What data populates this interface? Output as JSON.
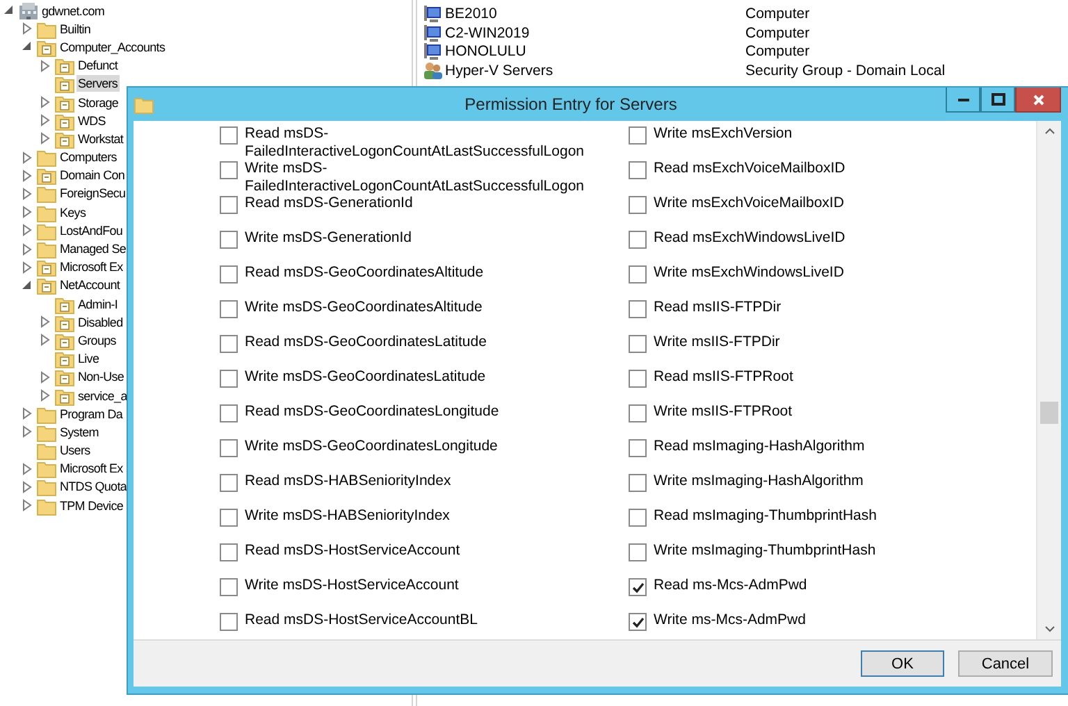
{
  "tree": [
    {
      "label": "gdwnet.com",
      "kind": "domain",
      "expandable": true,
      "expanded": true,
      "selected": false,
      "children": [
        {
          "label": "Builtin",
          "kind": "container",
          "expandable": true,
          "expanded": false,
          "selected": false
        },
        {
          "label": "Computer_Accounts",
          "kind": "ou",
          "expandable": true,
          "expanded": true,
          "selected": false,
          "children": [
            {
              "label": "Defunct",
              "kind": "ou",
              "expandable": true,
              "expanded": false,
              "selected": false
            },
            {
              "label": "Servers",
              "kind": "ou",
              "expandable": false,
              "expanded": false,
              "selected": true
            },
            {
              "label": "Storage",
              "kind": "ou",
              "expandable": true,
              "expanded": false,
              "selected": false
            },
            {
              "label": "WDS",
              "kind": "ou",
              "expandable": true,
              "expanded": false,
              "selected": false
            },
            {
              "label": "Workstat",
              "kind": "ou",
              "expandable": true,
              "expanded": false,
              "selected": false
            }
          ]
        },
        {
          "label": "Computers",
          "kind": "container",
          "expandable": true,
          "expanded": false,
          "selected": false
        },
        {
          "label": "Domain Con",
          "kind": "ou",
          "expandable": true,
          "expanded": false,
          "selected": false
        },
        {
          "label": "ForeignSecu",
          "kind": "container",
          "expandable": true,
          "expanded": false,
          "selected": false
        },
        {
          "label": "Keys",
          "kind": "container",
          "expandable": true,
          "expanded": false,
          "selected": false
        },
        {
          "label": "LostAndFou",
          "kind": "container",
          "expandable": true,
          "expanded": false,
          "selected": false
        },
        {
          "label": "Managed Se",
          "kind": "container",
          "expandable": true,
          "expanded": false,
          "selected": false
        },
        {
          "label": "Microsoft Ex",
          "kind": "ou",
          "expandable": true,
          "expanded": false,
          "selected": false
        },
        {
          "label": "NetAccount",
          "kind": "ou",
          "expandable": true,
          "expanded": true,
          "selected": false,
          "children": [
            {
              "label": "Admin-I",
              "kind": "ou",
              "expandable": false,
              "expanded": false,
              "selected": false
            },
            {
              "label": "Disabled",
              "kind": "ou",
              "expandable": true,
              "expanded": false,
              "selected": false
            },
            {
              "label": "Groups",
              "kind": "ou",
              "expandable": true,
              "expanded": false,
              "selected": false
            },
            {
              "label": "Live",
              "kind": "ou",
              "expandable": false,
              "expanded": false,
              "selected": false
            },
            {
              "label": "Non-Use",
              "kind": "ou",
              "expandable": true,
              "expanded": false,
              "selected": false
            },
            {
              "label": "service_a",
              "kind": "ou",
              "expandable": true,
              "expanded": false,
              "selected": false
            }
          ]
        },
        {
          "label": "Program Da",
          "kind": "container",
          "expandable": true,
          "expanded": false,
          "selected": false
        },
        {
          "label": "System",
          "kind": "container",
          "expandable": true,
          "expanded": false,
          "selected": false
        },
        {
          "label": "Users",
          "kind": "container",
          "expandable": false,
          "expanded": false,
          "selected": false
        },
        {
          "label": "Microsoft Ex",
          "kind": "container",
          "expandable": true,
          "expanded": false,
          "selected": false
        },
        {
          "label": "NTDS Quota",
          "kind": "container",
          "expandable": true,
          "expanded": false,
          "selected": false
        },
        {
          "label": "TPM Device",
          "kind": "container",
          "expandable": true,
          "expanded": false,
          "selected": false
        }
      ]
    }
  ],
  "objects": [
    {
      "name": "BE2010",
      "type": "Computer",
      "kind": "computer"
    },
    {
      "name": "C2-WIN2019",
      "type": "Computer",
      "kind": "computer"
    },
    {
      "name": "HONOLULU",
      "type": "Computer",
      "kind": "computer"
    },
    {
      "name": "Hyper-V Servers",
      "type": "Security Group - Domain Local",
      "kind": "group"
    }
  ],
  "dialog": {
    "title": "Permission Entry for Servers",
    "columns": [
      [
        {
          "label": "Read msDS-FailedInteractiveLogonCountAtLastSuccessfulLogon",
          "checked": false
        },
        {
          "label": "Write msDS-FailedInteractiveLogonCountAtLastSuccessfulLogon",
          "checked": false
        },
        {
          "label": "Read msDS-GenerationId",
          "checked": false
        },
        {
          "label": "Write msDS-GenerationId",
          "checked": false
        },
        {
          "label": "Read msDS-GeoCoordinatesAltitude",
          "checked": false
        },
        {
          "label": "Write msDS-GeoCoordinatesAltitude",
          "checked": false
        },
        {
          "label": "Read msDS-GeoCoordinatesLatitude",
          "checked": false
        },
        {
          "label": "Write msDS-GeoCoordinatesLatitude",
          "checked": false
        },
        {
          "label": "Read msDS-GeoCoordinatesLongitude",
          "checked": false
        },
        {
          "label": "Write msDS-GeoCoordinatesLongitude",
          "checked": false
        },
        {
          "label": "Read msDS-HABSeniorityIndex",
          "checked": false
        },
        {
          "label": "Write msDS-HABSeniorityIndex",
          "checked": false
        },
        {
          "label": "Read msDS-HostServiceAccount",
          "checked": false
        },
        {
          "label": "Write msDS-HostServiceAccount",
          "checked": false
        },
        {
          "label": "Read msDS-HostServiceAccountBL",
          "checked": false
        }
      ],
      [
        {
          "label": "Write msExchVersion",
          "checked": false
        },
        {
          "label": "Read msExchVoiceMailboxID",
          "checked": false
        },
        {
          "label": "Write msExchVoiceMailboxID",
          "checked": false
        },
        {
          "label": "Read msExchWindowsLiveID",
          "checked": false
        },
        {
          "label": "Write msExchWindowsLiveID",
          "checked": false
        },
        {
          "label": "Read msIIS-FTPDir",
          "checked": false
        },
        {
          "label": "Write msIIS-FTPDir",
          "checked": false
        },
        {
          "label": "Read msIIS-FTPRoot",
          "checked": false
        },
        {
          "label": "Write msIIS-FTPRoot",
          "checked": false
        },
        {
          "label": "Read msImaging-HashAlgorithm",
          "checked": false
        },
        {
          "label": "Write msImaging-HashAlgorithm",
          "checked": false
        },
        {
          "label": "Read msImaging-ThumbprintHash",
          "checked": false
        },
        {
          "label": "Write msImaging-ThumbprintHash",
          "checked": false
        },
        {
          "label": "Read ms-Mcs-AdmPwd",
          "checked": true
        },
        {
          "label": "Write ms-Mcs-AdmPwd",
          "checked": true
        }
      ]
    ],
    "buttons": [
      "OK",
      "Cancel"
    ]
  }
}
